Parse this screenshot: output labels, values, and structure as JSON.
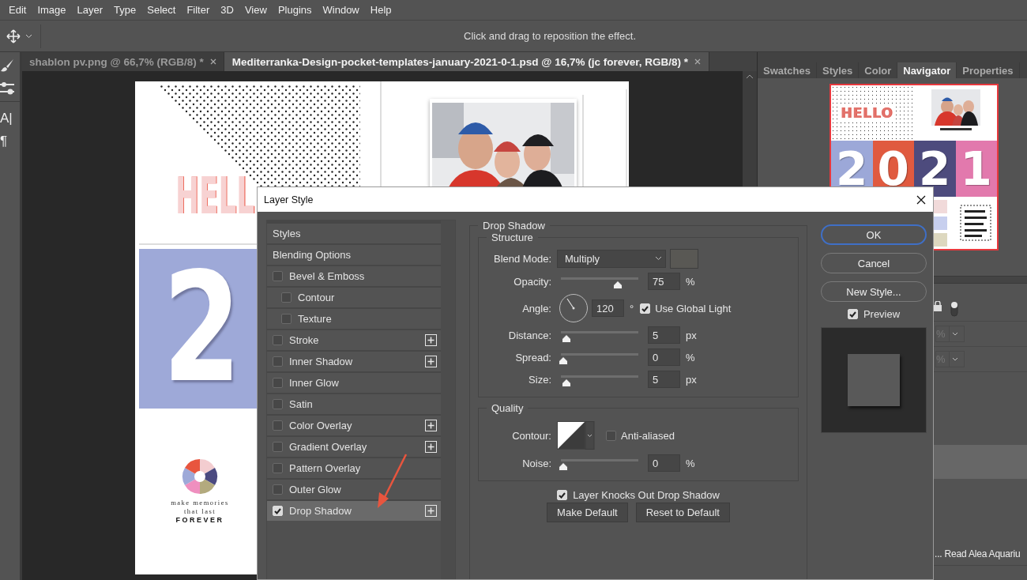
{
  "menu": [
    "Edit",
    "Image",
    "Layer",
    "Type",
    "Select",
    "Filter",
    "3D",
    "View",
    "Plugins",
    "Window",
    "Help"
  ],
  "options_bar": {
    "hint": "Click and drag to reposition the effect."
  },
  "tools": [
    {
      "kind": "brush"
    },
    {
      "kind": "sliders"
    },
    {
      "kind": "glyph",
      "glyph": "A|"
    },
    {
      "kind": "glyph",
      "glyph": "¶"
    }
  ],
  "document_tabs": [
    {
      "label": "shablon pv.png @ 66,7% (RGB/8) *",
      "selected": false
    },
    {
      "label": "Mediterranka-Design-pocket-templates-january-2021-0-1.psd @ 16,7% (jc forever, RGB/8) *",
      "selected": true
    }
  ],
  "document": {
    "hello": "HELL",
    "number": "2",
    "tagline": [
      "make memories",
      "that last",
      "FOREVER"
    ],
    "photo": {
      "kind": "picture"
    }
  },
  "panel_tabs": [
    {
      "label": "Swatches",
      "selected": false
    },
    {
      "label": "Styles",
      "selected": false
    },
    {
      "label": "Color",
      "selected": false
    },
    {
      "label": "Navigator",
      "selected": true
    },
    {
      "label": "Properties",
      "selected": false
    }
  ],
  "navigator": {
    "hello": "HELLO",
    "digits": [
      {
        "text": "2",
        "color": "#9ca8d8"
      },
      {
        "text": "0",
        "color": "#e05a3f"
      },
      {
        "text": "2",
        "color": "#4d4b7d"
      },
      {
        "text": "1",
        "color": "#e279ad"
      }
    ]
  },
  "layers": {
    "fields": [
      "%",
      "%"
    ],
    "layer_name": "... Read Alea Aquariu"
  },
  "dialog": {
    "title": "Layer Style",
    "style_list": [
      {
        "label": "Styles",
        "kind": "header",
        "selected": false
      },
      {
        "label": "Blending Options",
        "kind": "header",
        "selected": false
      },
      {
        "label": "Bevel & Emboss",
        "kind": "effect",
        "checked": false,
        "selected": false,
        "addable": false,
        "children": [
          {
            "label": "Contour",
            "kind": "effect",
            "checked": false,
            "selected": false,
            "addable": false
          },
          {
            "label": "Texture",
            "kind": "effect",
            "checked": false,
            "selected": false,
            "addable": false
          }
        ]
      },
      {
        "label": "Stroke",
        "kind": "effect",
        "checked": false,
        "selected": false,
        "addable": true
      },
      {
        "label": "Inner Shadow",
        "kind": "effect",
        "checked": false,
        "selected": false,
        "addable": true
      },
      {
        "label": "Inner Glow",
        "kind": "effect",
        "checked": false,
        "selected": false,
        "addable": false
      },
      {
        "label": "Satin",
        "kind": "effect",
        "checked": false,
        "selected": false,
        "addable": false
      },
      {
        "label": "Color Overlay",
        "kind": "effect",
        "checked": false,
        "selected": false,
        "addable": true
      },
      {
        "label": "Gradient Overlay",
        "kind": "effect",
        "checked": false,
        "selected": false,
        "addable": true
      },
      {
        "label": "Pattern Overlay",
        "kind": "effect",
        "checked": false,
        "selected": false,
        "addable": false
      },
      {
        "label": "Outer Glow",
        "kind": "effect",
        "checked": false,
        "selected": false,
        "addable": false
      },
      {
        "label": "Drop Shadow",
        "kind": "effect",
        "checked": true,
        "selected": true,
        "addable": true
      }
    ],
    "section_title": "Drop Shadow",
    "structure": {
      "legend": "Structure",
      "blend_label": "Blend Mode:",
      "blend_value": "Multiply",
      "rows": [
        {
          "kind": "slider",
          "label": "Opacity:",
          "level": 0.75,
          "value": "75",
          "unit": "%"
        },
        {
          "kind": "angle",
          "label": "Angle:",
          "value": "120",
          "unit": "°",
          "global_light": {
            "label": "Use Global Light",
            "checked": true
          }
        },
        {
          "kind": "slider",
          "label": "Distance:",
          "level": 0.04,
          "value": "5",
          "unit": "px"
        },
        {
          "kind": "slider",
          "label": "Spread:",
          "level": 0,
          "value": "0",
          "unit": "%"
        },
        {
          "kind": "slider",
          "label": "Size:",
          "level": 0.04,
          "value": "5",
          "unit": "px"
        }
      ]
    },
    "quality": {
      "legend": "Quality",
      "contour_label": "Contour:",
      "anti_aliased": {
        "label": "Anti-aliased",
        "checked": false
      },
      "rows": [
        {
          "kind": "slider",
          "label": "Noise:",
          "level": 0,
          "value": "0",
          "unit": "%"
        }
      ]
    },
    "knockout": {
      "label": "Layer Knocks Out Drop Shadow",
      "checked": true
    },
    "default_buttons": [
      "Make Default",
      "Reset to Default"
    ],
    "buttons": [
      {
        "label": "OK",
        "default": true
      },
      {
        "label": "Cancel",
        "default": false
      },
      {
        "label": "New Style...",
        "default": false
      }
    ],
    "preview": {
      "label": "Preview",
      "checked": true
    }
  }
}
